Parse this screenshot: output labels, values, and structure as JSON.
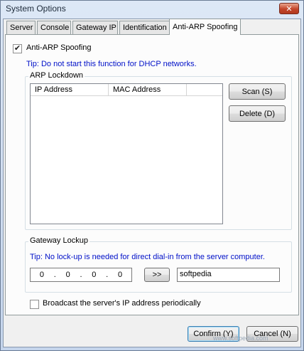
{
  "window": {
    "title": "System Options",
    "close_glyph": "✕"
  },
  "tabs": [
    {
      "label": "Server"
    },
    {
      "label": "Console"
    },
    {
      "label": "Gateway IP"
    },
    {
      "label": "Identification"
    },
    {
      "label": "Anti-ARP Spoofing",
      "active": true
    }
  ],
  "anti_arp": {
    "checkbox_label": "Anti-ARP Spoofing",
    "checked": true,
    "check_glyph": "✔"
  },
  "tip_dhcp": "Tip: Do not start this function for DHCP networks.",
  "arp_lockdown": {
    "caption": "ARP Lockdown",
    "columns": [
      "IP Address",
      "MAC Address"
    ],
    "rows": [],
    "scan_button": "Scan (S)",
    "delete_button": "Delete (D)"
  },
  "gateway_lockup": {
    "caption": "Gateway Lockup",
    "tip": "Tip: No lock-up is needed for direct dial-in from the server computer.",
    "ip_octets": [
      "0",
      "0",
      "0",
      "0"
    ],
    "ip_dot": ".",
    "arrow_button": ">>",
    "text_value": "softpedia"
  },
  "broadcast": {
    "checkbox_label": "Broadcast the server's IP address periodically",
    "checked": false
  },
  "footer": {
    "confirm_button": "Confirm (Y)",
    "cancel_button": "Cancel (N)"
  },
  "watermark": "www.softpedia.com",
  "colors": {
    "tip_text": "#0010c8",
    "close_button": "#c3452a",
    "title_bar": "#dde8f6"
  }
}
